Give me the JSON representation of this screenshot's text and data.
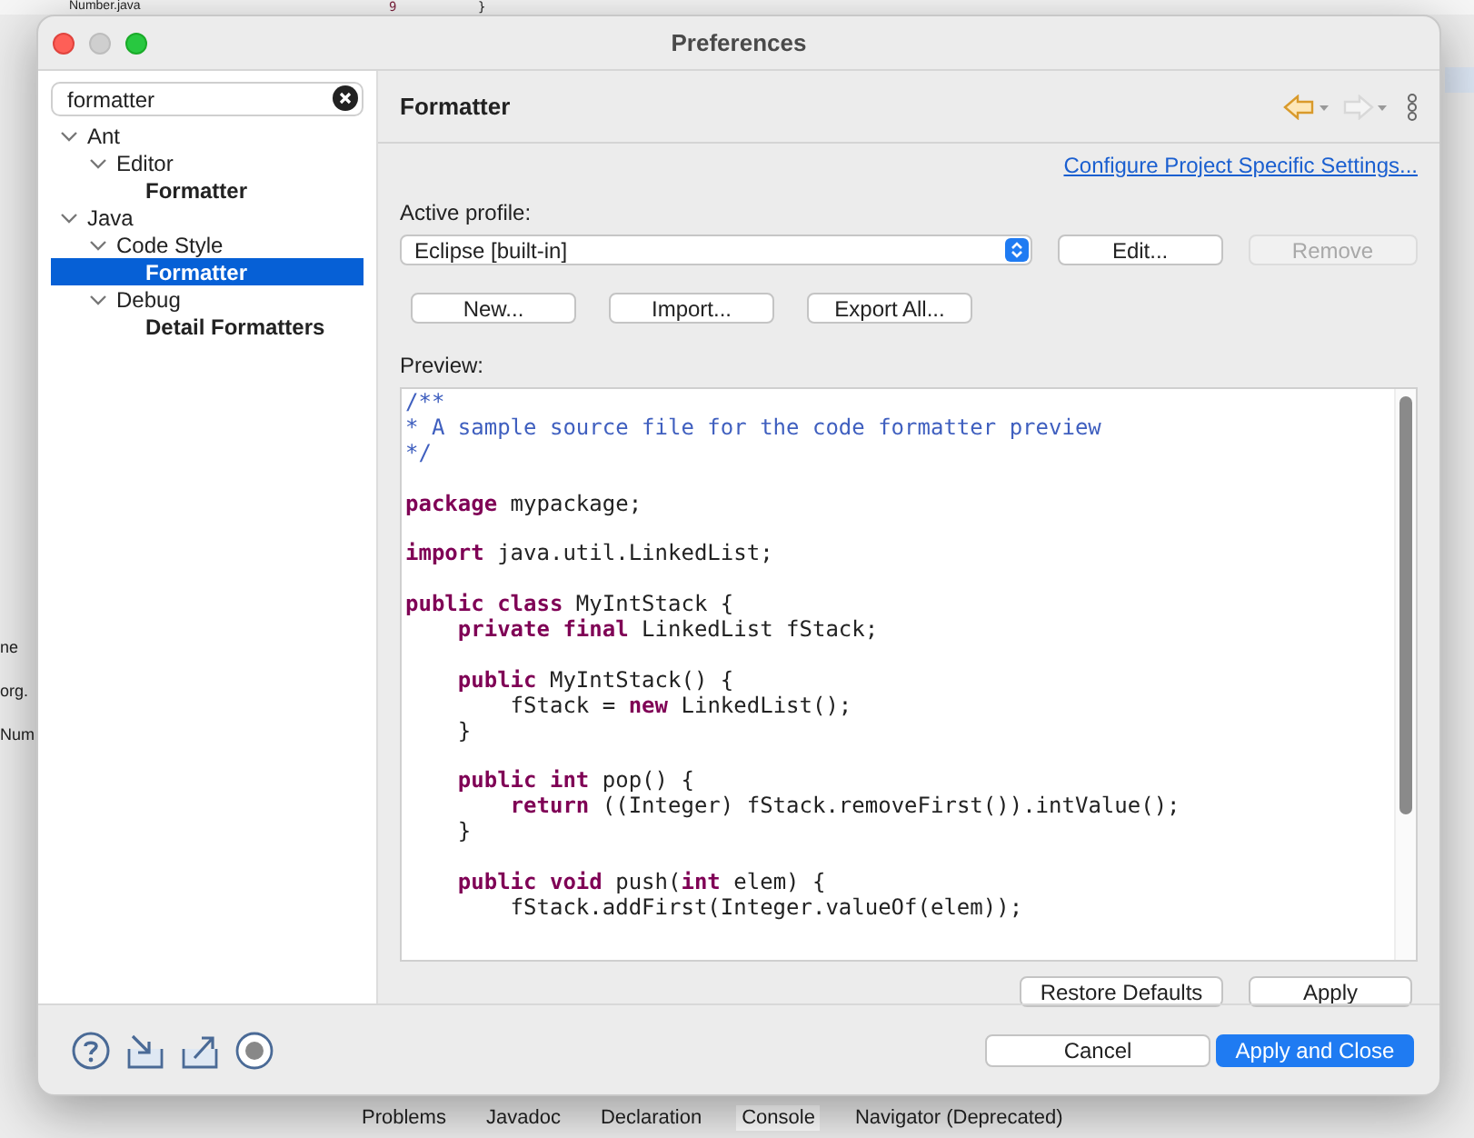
{
  "background_ide": {
    "editor_tab": "Number.java",
    "line_number": "9",
    "code_fragment": "}",
    "left_fragments": [
      "ne",
      "org.",
      "Num"
    ],
    "bottom_tabs": [
      {
        "label": "Problems",
        "selected": false
      },
      {
        "label": "Javadoc",
        "selected": false
      },
      {
        "label": "Declaration",
        "selected": false
      },
      {
        "label": "Console",
        "selected": true
      },
      {
        "label": "Navigator (Deprecated)",
        "selected": false
      }
    ]
  },
  "window": {
    "title": "Preferences"
  },
  "sidebar": {
    "search": {
      "value": "formatter"
    },
    "tree": [
      {
        "label": "Ant",
        "expanded": true,
        "selected": false,
        "children": [
          {
            "label": "Editor",
            "expanded": true,
            "selected": false,
            "children": [
              {
                "label": "Formatter",
                "selected": false
              }
            ]
          }
        ]
      },
      {
        "label": "Java",
        "expanded": true,
        "selected": false,
        "children": [
          {
            "label": "Code Style",
            "expanded": true,
            "selected": false,
            "children": [
              {
                "label": "Formatter",
                "selected": true
              }
            ]
          },
          {
            "label": "Debug",
            "expanded": true,
            "selected": false,
            "children": [
              {
                "label": "Detail Formatters",
                "selected": false
              }
            ]
          }
        ]
      }
    ]
  },
  "page": {
    "title": "Formatter",
    "nav_buttons": [
      {
        "kind": "back",
        "disabled": false
      },
      {
        "kind": "forward",
        "disabled": true
      }
    ],
    "link": "Configure Project Specific Settings...",
    "profile_label": "Active profile:",
    "profile": {
      "value": "Eclipse [built-in]"
    },
    "profile_buttons": [
      {
        "label": "Edit...",
        "disabled": false
      },
      {
        "label": "Remove",
        "disabled": true
      }
    ],
    "actions": [
      {
        "label": "New..."
      },
      {
        "label": "Import..."
      },
      {
        "label": "Export All..."
      }
    ],
    "preview_label": "Preview:",
    "preview": [
      {
        "kind": "code",
        "segments": [
          {
            "text": "/**",
            "kind": "comment"
          }
        ]
      },
      {
        "kind": "code",
        "segments": [
          {
            "text": "* A sample source file for the code formatter preview",
            "kind": "comment"
          }
        ]
      },
      {
        "kind": "code",
        "segments": [
          {
            "text": "*/",
            "kind": "comment"
          }
        ]
      },
      {
        "kind": "blank"
      },
      {
        "kind": "code",
        "segments": [
          {
            "text": "package",
            "kind": "keyword"
          },
          {
            "text": " mypackage;",
            "kind": "plain"
          }
        ]
      },
      {
        "kind": "blank"
      },
      {
        "kind": "code",
        "segments": [
          {
            "text": "import",
            "kind": "keyword"
          },
          {
            "text": " java.util.LinkedList;",
            "kind": "plain"
          }
        ]
      },
      {
        "kind": "blank"
      },
      {
        "kind": "code",
        "segments": [
          {
            "text": "public class",
            "kind": "keyword"
          },
          {
            "text": " MyIntStack {",
            "kind": "plain"
          }
        ]
      },
      {
        "kind": "code",
        "segments": [
          {
            "text": "    private final",
            "kind": "keyword"
          },
          {
            "text": " LinkedList fStack;",
            "kind": "plain"
          }
        ]
      },
      {
        "kind": "blank"
      },
      {
        "kind": "code",
        "segments": [
          {
            "text": "    public",
            "kind": "keyword"
          },
          {
            "text": " MyIntStack() {",
            "kind": "plain"
          }
        ]
      },
      {
        "kind": "code",
        "segments": [
          {
            "text": "        fStack = ",
            "kind": "plain"
          },
          {
            "text": "new",
            "kind": "keyword"
          },
          {
            "text": " LinkedList();",
            "kind": "plain"
          }
        ]
      },
      {
        "kind": "code",
        "segments": [
          {
            "text": "    }",
            "kind": "plain"
          }
        ]
      },
      {
        "kind": "blank"
      },
      {
        "kind": "code",
        "segments": [
          {
            "text": "    public int",
            "kind": "keyword"
          },
          {
            "text": " pop() {",
            "kind": "plain"
          }
        ]
      },
      {
        "kind": "code",
        "segments": [
          {
            "text": "        return",
            "kind": "keyword"
          },
          {
            "text": " ((Integer) fStack.removeFirst()).intValue();",
            "kind": "plain"
          }
        ]
      },
      {
        "kind": "code",
        "segments": [
          {
            "text": "    }",
            "kind": "plain"
          }
        ]
      },
      {
        "kind": "blank"
      },
      {
        "kind": "code",
        "segments": [
          {
            "text": "    public void",
            "kind": "keyword"
          },
          {
            "text": " push(",
            "kind": "plain"
          },
          {
            "text": "int",
            "kind": "keyword"
          },
          {
            "text": " elem) {",
            "kind": "plain"
          }
        ]
      },
      {
        "kind": "code",
        "segments": [
          {
            "text": "        fStack.addFirst(Integer.valueOf(elem));",
            "kind": "plain"
          }
        ]
      }
    ],
    "page_buttons": [
      {
        "label": "Restore Defaults"
      },
      {
        "label": "Apply"
      }
    ]
  },
  "footer": {
    "icons": [
      {
        "kind": "help"
      },
      {
        "kind": "import"
      },
      {
        "kind": "export"
      },
      {
        "kind": "record"
      }
    ],
    "buttons": [
      {
        "label": "Cancel",
        "default": false
      },
      {
        "label": "Apply and Close",
        "default": true
      }
    ]
  }
}
